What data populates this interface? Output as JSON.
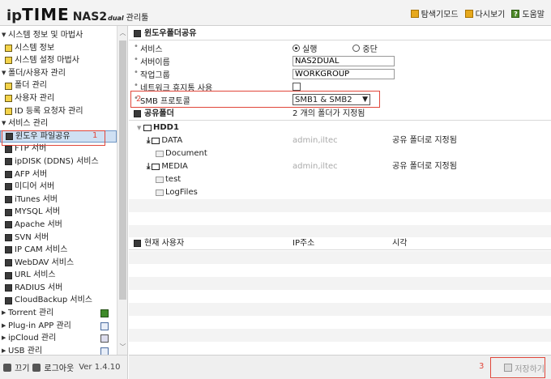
{
  "header": {
    "logo_ip": "ip",
    "logo_time": "TIME",
    "logo_model": "NAS2",
    "logo_dual": "dual",
    "logo_admin": "관리툴",
    "links": [
      {
        "label": "탐색기모드"
      },
      {
        "label": "다시보기"
      },
      {
        "label": "도움말"
      }
    ]
  },
  "sidebar": {
    "items": [
      {
        "label": "시스템 정보 및 마법사",
        "type": "group"
      },
      {
        "label": "시스템 정보",
        "type": "sub"
      },
      {
        "label": "시스템 설정 마법사",
        "type": "sub"
      },
      {
        "label": "폴더/사용자 관리",
        "type": "group"
      },
      {
        "label": "폴더 관리",
        "type": "sub"
      },
      {
        "label": "사용자 관리",
        "type": "sub"
      },
      {
        "label": "ID 등록 요청자 관리",
        "type": "sub"
      },
      {
        "label": "서비스 관리",
        "type": "group"
      },
      {
        "label": "윈도우 파일공유",
        "type": "sub",
        "selected": true
      },
      {
        "label": "FTP 서버",
        "type": "sub"
      },
      {
        "label": "ipDISK (DDNS) 서비스",
        "type": "sub"
      },
      {
        "label": "AFP 서버",
        "type": "sub"
      },
      {
        "label": "미디어 서버",
        "type": "sub"
      },
      {
        "label": "iTunes 서버",
        "type": "sub"
      },
      {
        "label": "MYSQL 서버",
        "type": "sub"
      },
      {
        "label": "Apache 서버",
        "type": "sub"
      },
      {
        "label": "SVN 서버",
        "type": "sub"
      },
      {
        "label": "IP CAM 서비스",
        "type": "sub"
      },
      {
        "label": "WebDAV 서비스",
        "type": "sub"
      },
      {
        "label": "URL 서비스",
        "type": "sub"
      },
      {
        "label": "RADIUS 서버",
        "type": "sub"
      },
      {
        "label": "CloudBackup 서비스",
        "type": "sub"
      },
      {
        "label": "Torrent 관리",
        "type": "group"
      },
      {
        "label": "Plug-in APP 관리",
        "type": "group"
      },
      {
        "label": "ipCloud 관리",
        "type": "group"
      },
      {
        "label": "USB 관리",
        "type": "group"
      }
    ],
    "footer": {
      "power_label": "끄기",
      "logout_label": "로그아웃",
      "version": "Ver 1.4.10"
    }
  },
  "annotations": {
    "one": "1",
    "two": "2",
    "three": "3"
  },
  "main": {
    "section_title": "윈도우폴더공유",
    "fields": {
      "service_label": "서비스",
      "service_on": "실행",
      "service_off": "중단",
      "server_name_label": "서버이름",
      "server_name_value": "NAS2DUAL",
      "workgroup_label": "작업그룹",
      "workgroup_value": "WORKGROUP",
      "recycle_label": "네트워크 휴지통 사용",
      "smb_label": "SMB 프로토콜",
      "smb_value": "SMB1 & SMB2"
    },
    "share": {
      "header_label": "공유폴더",
      "header_count": "2 개의 폴더가 지정됨",
      "disk": "HDD1",
      "folders": [
        {
          "name": "DATA",
          "users": "admin,iltec",
          "status": "공유 폴더로 지정됨",
          "children": [
            "Document"
          ]
        },
        {
          "name": "MEDIA",
          "users": "admin,iltec",
          "status": "공유 폴더로 지정됨",
          "children": [
            "test",
            "LogFiles"
          ]
        }
      ]
    },
    "users": {
      "col_user": "현재 사용자",
      "col_ip": "IP주소",
      "col_time": "시각"
    },
    "save_label": "저장하기"
  }
}
